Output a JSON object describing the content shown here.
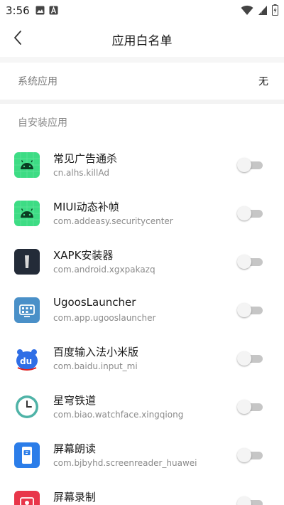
{
  "status_bar": {
    "time": "3:56",
    "left_icons": [
      "image-icon",
      "a-badge-icon"
    ],
    "right_icons": [
      "wifi-icon",
      "signal-icon",
      "battery-icon"
    ]
  },
  "header": {
    "title": "应用白名单",
    "back_icon": "chevron-left-icon"
  },
  "system_apps": {
    "label": "系统应用",
    "value": "无"
  },
  "installed_section": {
    "title": "自安装应用"
  },
  "apps": [
    {
      "name": "常见广告通杀",
      "package": "cn.alhs.killAd",
      "icon": "android-icon",
      "enabled": false
    },
    {
      "name": "MIUI动态补帧",
      "package": "com.addeasy.securitycenter",
      "icon": "android-icon",
      "enabled": false
    },
    {
      "name": "XAPK安装器",
      "package": "com.android.xgxpakazq",
      "icon": "xapk-icon",
      "enabled": false
    },
    {
      "name": "UgoosLauncher",
      "package": "com.app.ugooslauncher",
      "icon": "launcher-icon",
      "enabled": false
    },
    {
      "name": "百度输入法小米版",
      "package": "com.baidu.input_mi",
      "icon": "baidu-input-icon",
      "enabled": false
    },
    {
      "name": "星穹铁道",
      "package": "com.biao.watchface.xingqiong",
      "icon": "clock-icon",
      "enabled": false
    },
    {
      "name": "屏幕朗读",
      "package": "com.bjbyhd.screenreader_huawei",
      "icon": "screen-reader-icon",
      "enabled": false
    },
    {
      "name": "屏幕录制",
      "package": "",
      "icon": "screen-record-icon",
      "enabled": false
    }
  ]
}
